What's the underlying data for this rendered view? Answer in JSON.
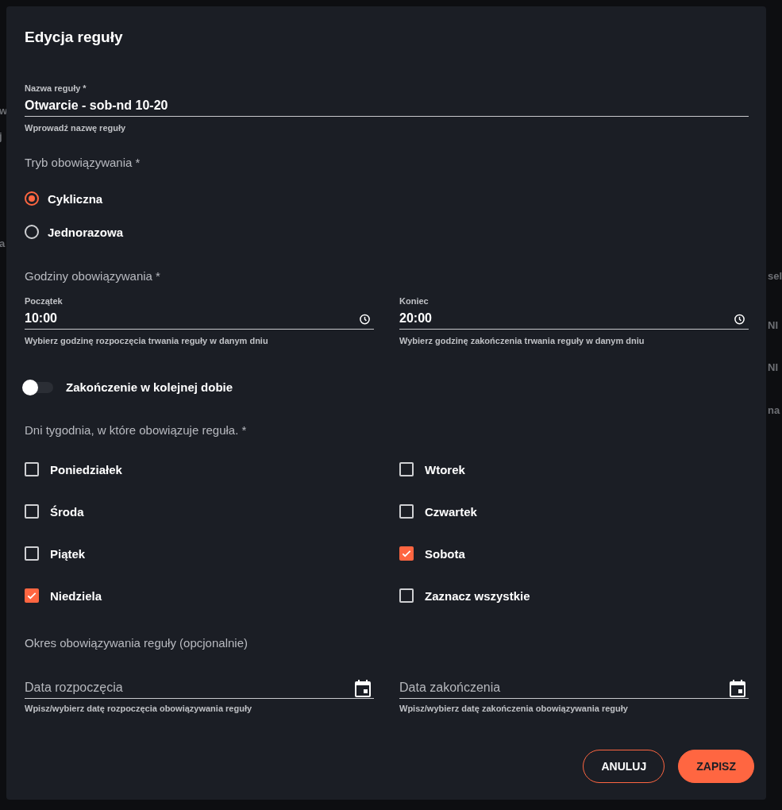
{
  "background": {
    "left_fragments": [
      "w",
      "j",
      "a"
    ],
    "right_fragments": [
      "sel",
      "NI",
      "NI",
      "na"
    ]
  },
  "dialog": {
    "title": "Edycja reguły",
    "name_field": {
      "label": "Nazwa reguły *",
      "value": "Otwarcie - sob-nd 10-20",
      "helper": "Wprowadź nazwę reguły"
    },
    "mode": {
      "heading": "Tryb obowiązywania *",
      "options": [
        {
          "label": "Cykliczna",
          "selected": true
        },
        {
          "label": "Jednorazowa",
          "selected": false
        }
      ]
    },
    "hours": {
      "heading": "Godziny obowiązywania *",
      "fields": [
        {
          "label": "Początek",
          "value": "10:00",
          "helper": "Wybierz godzinę rozpoczęcia trwania reguły w danym dniu"
        },
        {
          "label": "Koniec",
          "value": "20:00",
          "helper": "Wybierz godzinę zakończenia trwania reguły w danym dniu"
        }
      ]
    },
    "next_day_toggle": {
      "label": "Zakończenie w kolejnej dobie",
      "on": false
    },
    "days": {
      "heading": "Dni tygodnia, w które obowiązuje reguła. *",
      "items": [
        {
          "label": "Poniedziałek",
          "checked": false
        },
        {
          "label": "Wtorek",
          "checked": false
        },
        {
          "label": "Środa",
          "checked": false
        },
        {
          "label": "Czwartek",
          "checked": false
        },
        {
          "label": "Piątek",
          "checked": false
        },
        {
          "label": "Sobota",
          "checked": true
        },
        {
          "label": "Niedziela",
          "checked": true
        },
        {
          "label": "Zaznacz wszystkie",
          "checked": false
        }
      ]
    },
    "period": {
      "heading": "Okres obowiązywania reguły (opcjonalnie)",
      "fields": [
        {
          "placeholder": "Data rozpoczęcia",
          "helper": "Wpisz/wybierz datę rozpoczęcia obowiązywania reguły"
        },
        {
          "placeholder": "Data zakończenia",
          "helper": "Wpisz/wybierz datę zakończenia obowiązywania reguły"
        }
      ]
    },
    "buttons": [
      {
        "label": "ANULUJ",
        "kind": "outline"
      },
      {
        "label": "ZAPISZ",
        "kind": "filled"
      }
    ]
  }
}
